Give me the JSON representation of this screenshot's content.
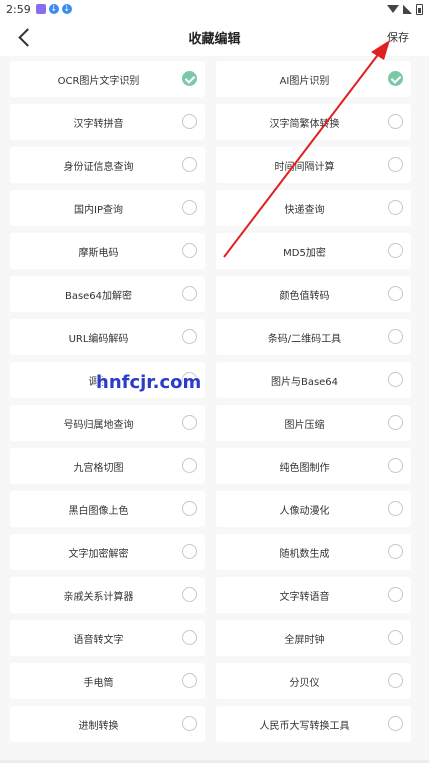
{
  "status": {
    "time": "2:59"
  },
  "header": {
    "title": "收藏编辑",
    "save_label": "保存"
  },
  "items": [
    {
      "label": "OCR图片文字识别",
      "checked": true
    },
    {
      "label": "AI图片识别",
      "checked": true
    },
    {
      "label": "汉字转拼音",
      "checked": false
    },
    {
      "label": "汉字简繁体转换",
      "checked": false
    },
    {
      "label": "身份证信息查询",
      "checked": false
    },
    {
      "label": "时间间隔计算",
      "checked": false
    },
    {
      "label": "国内IP查询",
      "checked": false
    },
    {
      "label": "快递查询",
      "checked": false
    },
    {
      "label": "摩斯电码",
      "checked": false
    },
    {
      "label": "MD5加密",
      "checked": false
    },
    {
      "label": "Base64加解密",
      "checked": false
    },
    {
      "label": "颜色值转码",
      "checked": false
    },
    {
      "label": "URL编码解码",
      "checked": false
    },
    {
      "label": "条码/二维码工具",
      "checked": false
    },
    {
      "label": "调色",
      "checked": false
    },
    {
      "label": "图片与Base64",
      "checked": false
    },
    {
      "label": "号码归属地查询",
      "checked": false
    },
    {
      "label": "图片压缩",
      "checked": false
    },
    {
      "label": "九宫格切图",
      "checked": false
    },
    {
      "label": "纯色图制作",
      "checked": false
    },
    {
      "label": "黑白图像上色",
      "checked": false
    },
    {
      "label": "人像动漫化",
      "checked": false
    },
    {
      "label": "文字加密解密",
      "checked": false
    },
    {
      "label": "随机数生成",
      "checked": false
    },
    {
      "label": "亲戚关系计算器",
      "checked": false
    },
    {
      "label": "文字转语音",
      "checked": false
    },
    {
      "label": "语音转文字",
      "checked": false
    },
    {
      "label": "全屏时钟",
      "checked": false
    },
    {
      "label": "手电筒",
      "checked": false
    },
    {
      "label": "分贝仪",
      "checked": false
    },
    {
      "label": "进制转换",
      "checked": false
    },
    {
      "label": "人民币大写转换工具",
      "checked": false
    }
  ],
  "watermark": "hnfcjr.com",
  "colors": {
    "check_on": "#7ac8a8",
    "arrow": "#e02020",
    "watermark": "#2a3cc8"
  }
}
